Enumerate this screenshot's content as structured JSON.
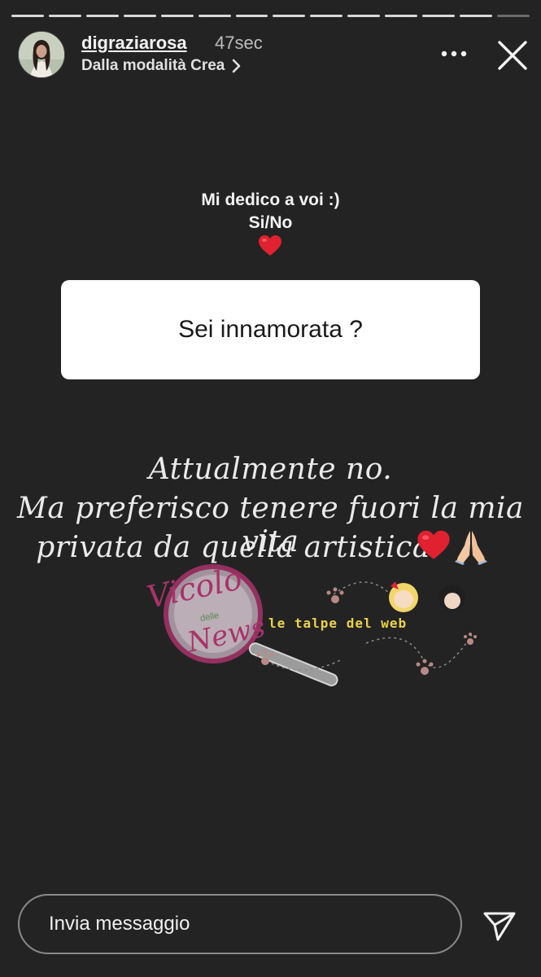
{
  "header": {
    "username": "digraziarosa",
    "time": "47sec",
    "subtitle": "Dalla modalità Crea",
    "subtitle_chevron": "chevron-right-icon",
    "more_icon": "more-horizontal-icon",
    "close_icon": "close-icon"
  },
  "progress": {
    "segments": 14,
    "active_segment": 14
  },
  "sticker": {
    "prompt_line1": "Mi dedico a voi :)",
    "prompt_line2": "Si/No",
    "prompt_emoji": "red-heart",
    "question": "Sei innamorata ?"
  },
  "answer": {
    "line1": "Attualmente no.",
    "line2": "Ma preferisco tenere fuori la mia vita",
    "line3": "privata da quella artistica.",
    "emojis": [
      "red-heart",
      "folded-hands"
    ]
  },
  "watermark": {
    "script_top": "Vicolo",
    "script_small": "delle",
    "script_bottom": "News",
    "brand": "le talpe del web"
  },
  "footer": {
    "message_placeholder": "Invia messaggio",
    "send_icon": "send-icon"
  },
  "colors": {
    "background": "#232323",
    "card": "#ffffff",
    "heart": "#e0212f",
    "watermark_pink": "#a8336a",
    "watermark_yellow": "#e9d24a"
  }
}
